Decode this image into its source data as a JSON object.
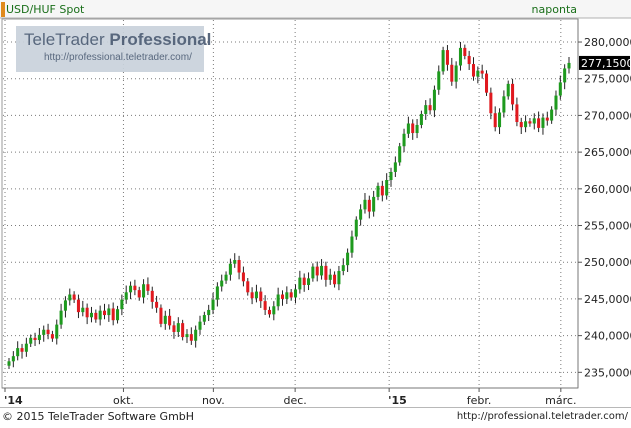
{
  "header": {
    "symbol": "USD/HUF Spot",
    "period": "naponta"
  },
  "logo": {
    "name_light": "TeleTrader",
    "name_bold": "Professional",
    "url": "http://professional.teletrader.com/"
  },
  "footer": {
    "copyright": "© 2015 TeleTrader Software GmbH",
    "url": "http://professional.teletrader.com/"
  },
  "colors": {
    "up": "#1e9a1e",
    "down": "#e0191f",
    "grid": "#7a7a7a",
    "last_price_bg": "#000000"
  },
  "chart_data": {
    "type": "candlestick",
    "title": "USD/HUF Spot",
    "interval": "naponta",
    "x_ticks": [
      "'14",
      "okt.",
      "nov.",
      "dec.",
      "'15",
      "febr.",
      "márc."
    ],
    "y_ticks": [
      "235,0000",
      "240,0000",
      "245,0000",
      "250,0000",
      "255,0000",
      "260,0000",
      "265,0000",
      "270,0000",
      "275,0000",
      "280,0000"
    ],
    "ylim": [
      233,
      283
    ],
    "last_price": "277,1500",
    "grid": true,
    "close": [
      236.5,
      237.2,
      238.3,
      237.8,
      238.9,
      239.7,
      239.4,
      240.1,
      240.8,
      240.2,
      239.6,
      241.5,
      243.4,
      244.8,
      245.6,
      244.9,
      243.2,
      243.8,
      242.5,
      243.1,
      242.2,
      243.4,
      242.8,
      243.7,
      242.1,
      243.6,
      244.9,
      245.9,
      246.8,
      246.2,
      245.2,
      247.0,
      246.1,
      244.6,
      243.8,
      241.6,
      242.7,
      241.4,
      240.5,
      241.7,
      239.8,
      240.2,
      239.3,
      240.8,
      241.9,
      242.8,
      243.5,
      244.9,
      246.7,
      247.5,
      248.3,
      249.8,
      250.3,
      248.6,
      247.4,
      245.9,
      245.1,
      246.0,
      244.7,
      243.5,
      242.9,
      244.0,
      245.6,
      245.0,
      245.9,
      245.2,
      246.3,
      247.9,
      246.9,
      247.8,
      249.4,
      248.2,
      249.5,
      247.6,
      248.3,
      247.0,
      248.8,
      249.6,
      251.3,
      253.5,
      255.8,
      257.2,
      258.5,
      256.9,
      258.9,
      260.4,
      259.1,
      261.2,
      262.3,
      263.6,
      265.8,
      267.5,
      268.9,
      267.6,
      268.7,
      270.2,
      271.4,
      270.7,
      273.5,
      276.0,
      278.9,
      276.9,
      274.6,
      276.8,
      279.2,
      278.1,
      277.0,
      275.3,
      276.1,
      275.7,
      273.1,
      270.3,
      268.4,
      270.4,
      272.6,
      274.3,
      271.5,
      269.1,
      268.4,
      269.2,
      268.9,
      269.6,
      268.3,
      269.7,
      269.3,
      270.8,
      272.7,
      274.5,
      276.4,
      277.15
    ]
  }
}
